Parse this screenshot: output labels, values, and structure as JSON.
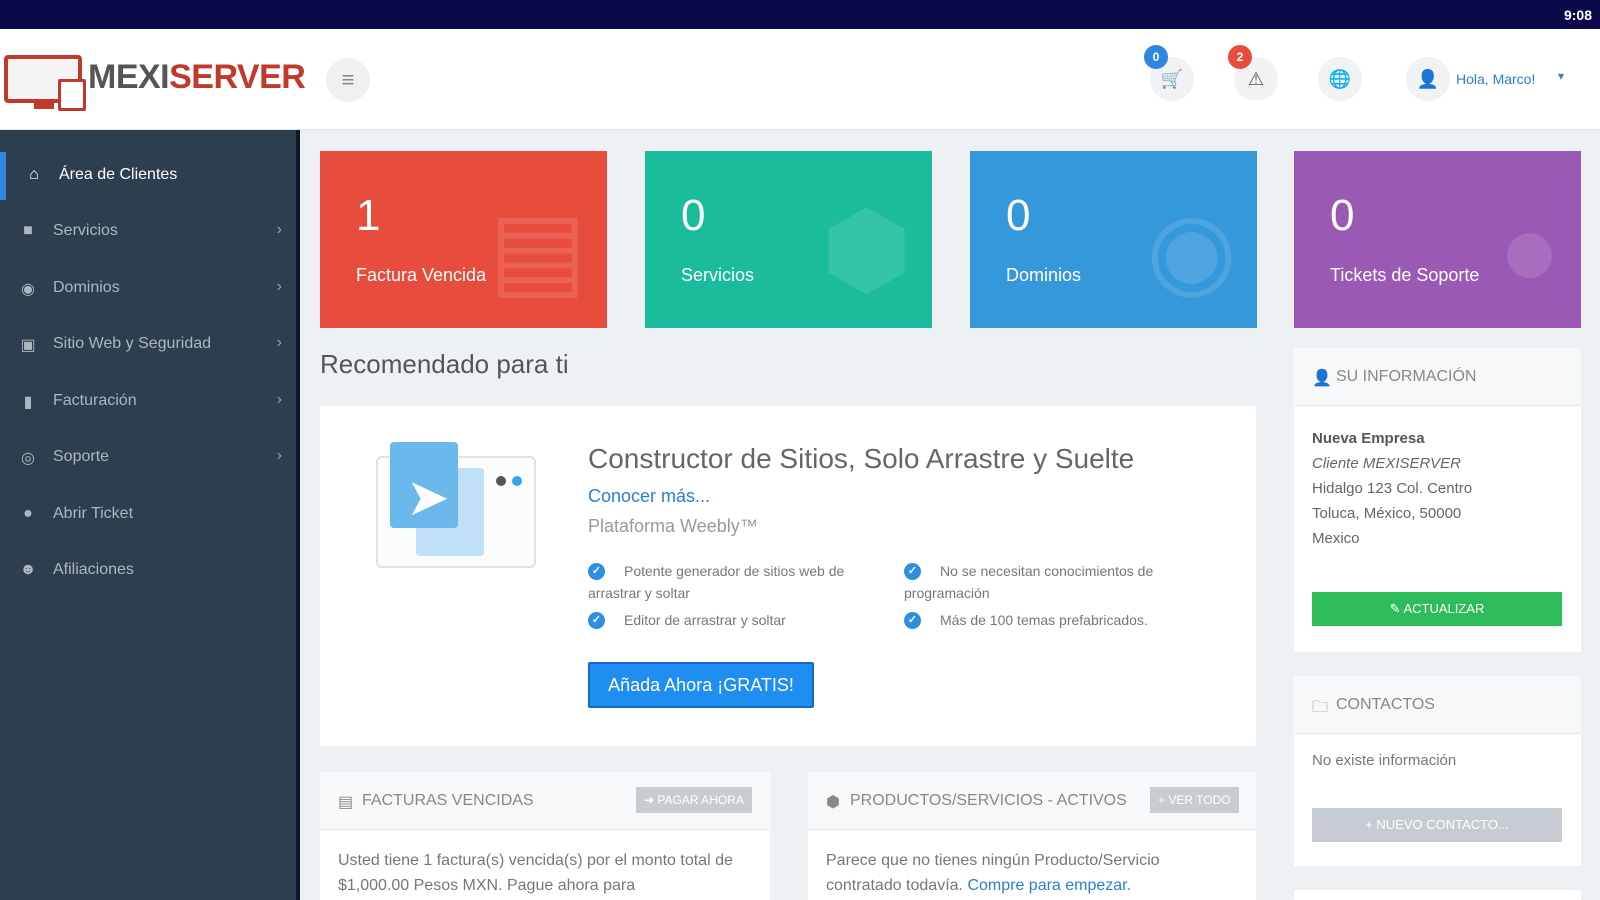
{
  "status_bar": {
    "time": "9:08"
  },
  "header": {
    "logo_part1": "MEXI",
    "logo_part2": "SERVER",
    "menu_icon": "hamburger-icon",
    "cart_badge": "0",
    "alerts_badge": "2",
    "user_greeting": "Hola, Marco!"
  },
  "sidebar": {
    "items": [
      {
        "label": "Área de Clientes",
        "icon": "home-icon",
        "active": true
      },
      {
        "label": "Servicios",
        "icon": "box-icon"
      },
      {
        "label": "Dominios",
        "icon": "globe-icon"
      },
      {
        "label": "Sitio Web y Seguridad",
        "icon": "monitor-icon"
      },
      {
        "label": "Facturación",
        "icon": "file-icon"
      },
      {
        "label": "Soporte",
        "icon": "lifebuoy-icon"
      },
      {
        "label": "Abrir Ticket",
        "icon": "comment-icon"
      },
      {
        "label": "Afiliaciones",
        "icon": "users-icon"
      }
    ]
  },
  "tiles": [
    {
      "value": "1",
      "label": "Factura Vencida",
      "color": "#e74c3c",
      "icon": "invoice-icon"
    },
    {
      "value": "0",
      "label": "Servicios",
      "color": "#1abc9c",
      "icon": "cube-icon"
    },
    {
      "value": "0",
      "label": "Dominios",
      "color": "#3498db",
      "icon": "globe-icon"
    },
    {
      "value": "0",
      "label": "Tickets de Soporte",
      "color": "#9b59b6",
      "icon": "comments-icon"
    }
  ],
  "recommended": {
    "heading": "Recomendado para ti",
    "title": "Constructor de Sitios, Solo Arrastre y Suelte",
    "more_link": "Conocer más...",
    "subtitle": "Plataforma Weebly™",
    "features": [
      "Potente generador de sitios web de arrastrar y soltar",
      "No se necesitan conocimientos de programación",
      "Editor de arrastrar y soltar",
      "Más de 100 temas prefabricados."
    ],
    "cta": "Añada Ahora ¡GRATIS!"
  },
  "your_info": {
    "title": "SU INFORMACIÓN",
    "company": "Nueva Empresa",
    "client": "Cliente MEXISERVER",
    "address1": "Hidalgo 123 Col. Centro",
    "address2": "Toluca, México, 50000",
    "country": "Mexico",
    "update_button": "ACTUALIZAR"
  },
  "contacts": {
    "title": "CONTACTOS",
    "empty": "No existe información",
    "new_button": "NUEVO CONTACTO..."
  },
  "overdue_panel": {
    "title": "FACTURAS VENCIDAS",
    "button": "PAGAR AHORA",
    "text": "Usted tiene 1 factura(s) vencida(s) por el monto total de $1,000.00 Pesos MXN. Pague ahora para"
  },
  "products_panel": {
    "title": "PRODUCTOS/SERVICIOS - ACTIVOS",
    "button": "VER TODO",
    "text": "Parece que no tienes ningún Producto/Servicio contratado todavía.",
    "link": "Compre para empezar."
  }
}
